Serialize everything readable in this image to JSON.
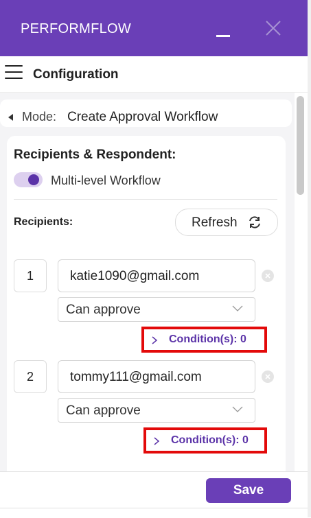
{
  "app": {
    "title": "PERFORMFLOW"
  },
  "header": {
    "title": "Configuration"
  },
  "mode": {
    "label": "Mode:",
    "value": "Create Approval Workflow"
  },
  "panel": {
    "section_title": "Recipients & Respondent:",
    "toggle": {
      "label": "Multi-level Workflow",
      "checked": true
    },
    "recipients_label": "Recipients:",
    "refresh_label": "Refresh"
  },
  "recipients": [
    {
      "number": "1",
      "email": "katie1090@gmail.com",
      "permission": "Can approve",
      "conditions_label": "Condition(s): 0"
    },
    {
      "number": "2",
      "email": "tommy111@gmail.com",
      "permission": "Can approve",
      "conditions_label": "Condition(s): 0"
    }
  ],
  "footer": {
    "save_label": "Save"
  },
  "colors": {
    "brand": "#6a3fb7",
    "accent_text": "#5b33a8",
    "highlight": "#e30a0a"
  }
}
